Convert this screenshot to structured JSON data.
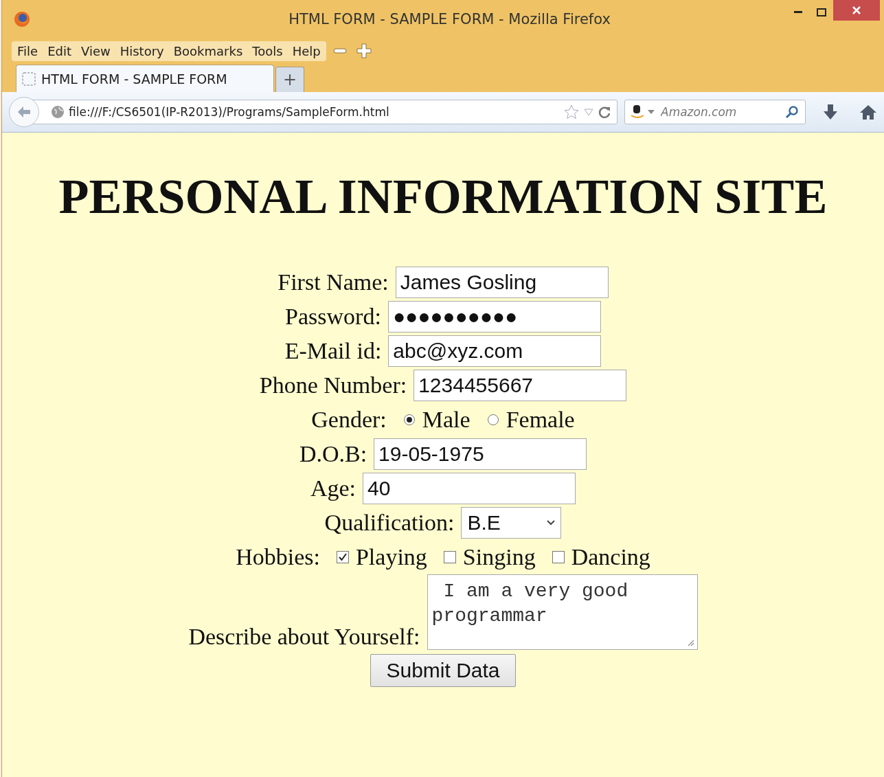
{
  "window": {
    "title": "HTML FORM - SAMPLE FORM - Mozilla Firefox"
  },
  "menu": [
    "File",
    "Edit",
    "View",
    "History",
    "Bookmarks",
    "Tools",
    "Help"
  ],
  "tabs": [
    {
      "label": "HTML FORM - SAMPLE FORM",
      "selected": true
    }
  ],
  "new_tab": "+",
  "address": {
    "url": "file:///F:/CS6501(IP-R2013)/Programs/SampleForm.html"
  },
  "search": {
    "placeholder": "Amazon.com"
  },
  "page": {
    "heading": "PERSONAL INFORMATION SITE",
    "fields": [
      {
        "kind": "text",
        "label": "First Name:",
        "value": "James Gosling"
      },
      {
        "kind": "text",
        "label": "Password:",
        "value": "●●●●●●●●●●"
      },
      {
        "kind": "text",
        "label": "E-Mail id:",
        "value": "abc@xyz.com"
      },
      {
        "kind": "text",
        "label": "Phone Number:",
        "value": "1234455667"
      },
      {
        "kind": "radio",
        "label": "Gender:",
        "options": [
          {
            "label": "Male",
            "selected": true
          },
          {
            "label": "Female",
            "selected": false
          }
        ]
      },
      {
        "kind": "text",
        "label": "D.O.B:",
        "value": "19-05-1975"
      },
      {
        "kind": "text",
        "label": "Age:",
        "value": "40"
      },
      {
        "kind": "select",
        "label": "Qualification:",
        "value": "B.E"
      },
      {
        "kind": "checkbox",
        "label": "Hobbies:",
        "options": [
          {
            "label": "Playing",
            "checked": true
          },
          {
            "label": "Singing",
            "checked": false
          },
          {
            "label": "Dancing",
            "checked": false
          }
        ]
      },
      {
        "kind": "textarea",
        "label": "Describe about Yourself:",
        "value": " I am a very good programmar"
      }
    ],
    "submit": "Submit Data"
  }
}
